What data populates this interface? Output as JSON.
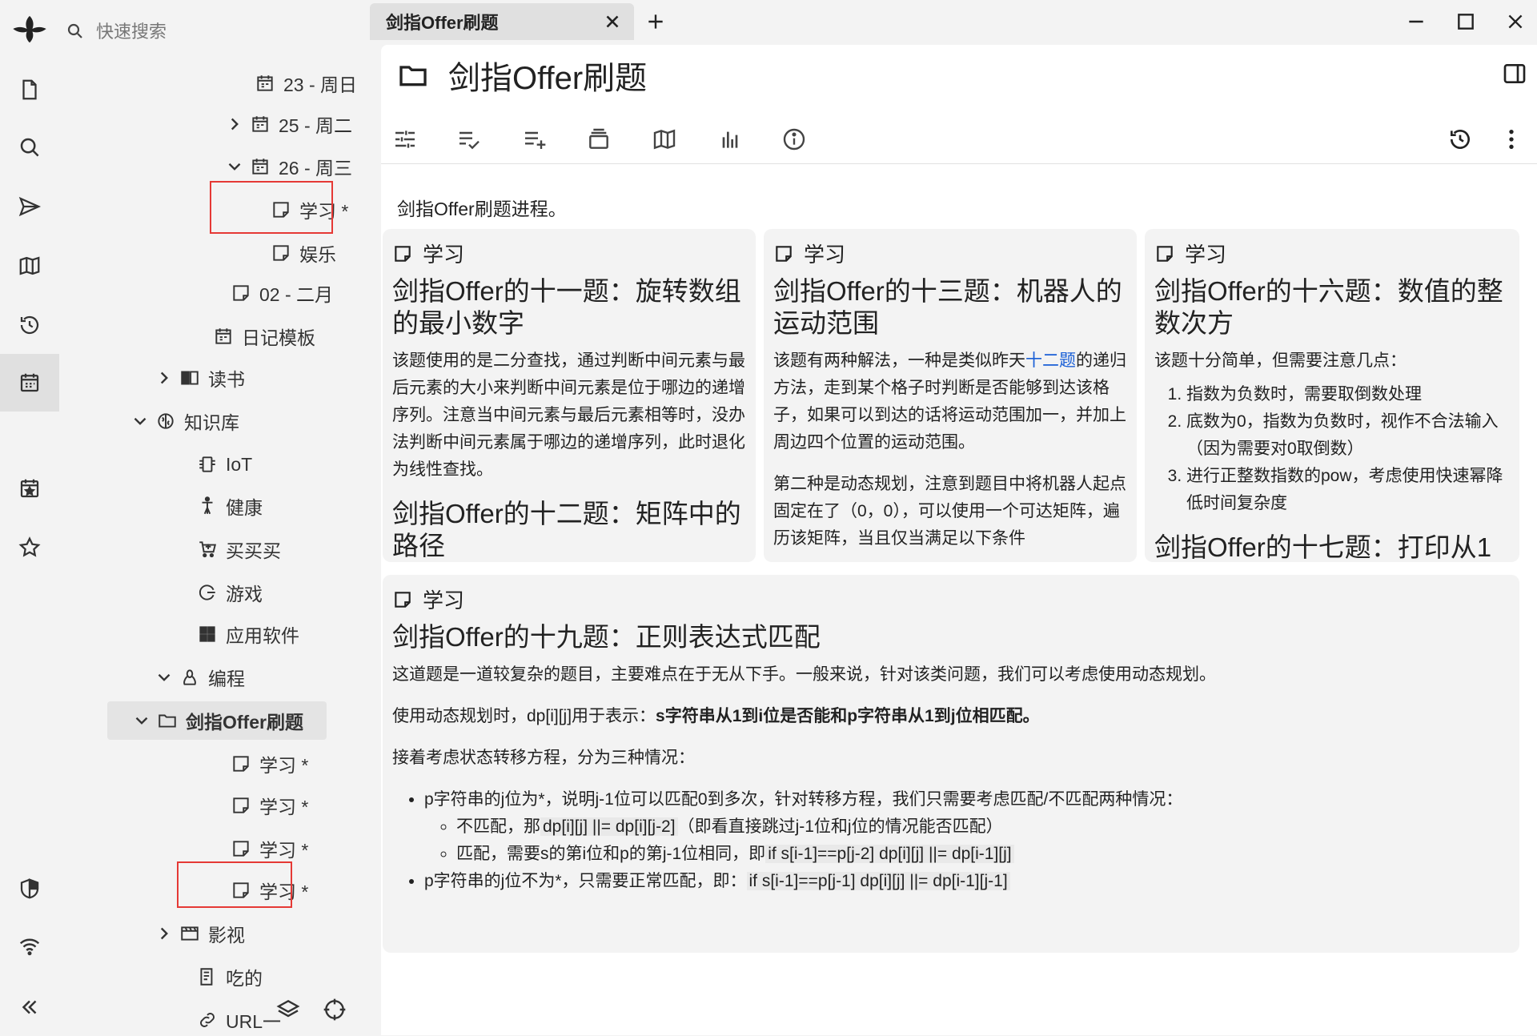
{
  "app": {
    "search_placeholder": "快速搜索"
  },
  "tabs": [
    {
      "title": "剑指Offer刷题"
    }
  ],
  "tree": [
    {
      "label": "23 - 周日",
      "icon": "calendar-icon",
      "chev": "none"
    },
    {
      "label": "25 - 周二",
      "icon": "calendar-icon",
      "chev": "right"
    },
    {
      "label": "26 - 周三",
      "icon": "calendar-icon",
      "chev": "down"
    },
    {
      "label": "学习 *",
      "icon": "note-icon",
      "chev": "none"
    },
    {
      "label": "娱乐",
      "icon": "note-icon",
      "chev": "none"
    },
    {
      "label": "02 - 二月",
      "icon": "note-icon",
      "chev": "none"
    },
    {
      "label": "日记模板",
      "icon": "calendar-icon",
      "chev": "none"
    },
    {
      "label": "读书",
      "icon": "book-icon",
      "chev": "right"
    },
    {
      "label": "知识库",
      "icon": "brain-icon",
      "chev": "down"
    },
    {
      "label": "IoT",
      "icon": "chip-icon",
      "chev": "none"
    },
    {
      "label": "健康",
      "icon": "person-icon",
      "chev": "none"
    },
    {
      "label": "买买买",
      "icon": "cart-icon",
      "chev": "none"
    },
    {
      "label": "游戏",
      "icon": "game-icon",
      "chev": "none"
    },
    {
      "label": "应用软件",
      "icon": "apps-icon",
      "chev": "none"
    },
    {
      "label": "编程",
      "icon": "linux-icon",
      "chev": "down"
    },
    {
      "label": "剑指Offer刷题",
      "icon": "folder-icon",
      "chev": "down"
    },
    {
      "label": "学习 *",
      "icon": "note-icon",
      "chev": "none"
    },
    {
      "label": "学习 *",
      "icon": "note-icon",
      "chev": "none"
    },
    {
      "label": "学习 *",
      "icon": "note-icon",
      "chev": "none"
    },
    {
      "label": "学习 *",
      "icon": "note-icon",
      "chev": "none"
    },
    {
      "label": "影视",
      "icon": "film-icon",
      "chev": "right"
    },
    {
      "label": "吃的",
      "icon": "menu-book-icon",
      "chev": "none"
    },
    {
      "label": "URL一",
      "icon": "link-icon",
      "chev": "none"
    }
  ],
  "note": {
    "title": "剑指Offer刷题",
    "description": "剑指Offer刷题进程。"
  },
  "cards": [
    {
      "label": "学习",
      "title1": "剑指Offer的十一题：旋转数组的最小数字",
      "para1": "该题使用的是二分查找，通过判断中间元素与最后元素的大小来判断中间元素是位于哪边的递增序列。注意当中间元素与最后元素相等时，没办法判断中间元素属于哪边的递增序列，此时退化为线性查找。",
      "title2": "剑指Offer的十二题：矩阵中的路径"
    },
    {
      "label": "学习",
      "title1": "剑指Offer的十三题：机器人的运动范围",
      "para1_a": "该题有两种解法，一种是类似昨天",
      "para1_link": "十二题",
      "para1_b": "的递归方法，走到某个格子时判断是否能够到达该格子，如果可以到达的话将运动范围加一，并加上周边四个位置的运动范围。",
      "para2": "第二种是动态规划，注意到题目中将机器人起点固定在了（0，0），可以使用一个可达矩阵，遍历该矩阵，当且仅当满足以下条件"
    },
    {
      "label": "学习",
      "title1": "剑指Offer的十六题：数值的整数次方",
      "para1": "该题十分简单，但需要注意几点：",
      "items": [
        "指数为负数时，需要取倒数处理",
        "底数为0，指数为负数时，视作不合法输入（因为需要对0取倒数）",
        "进行正整数指数的pow，考虑使用快速幂降低时间复杂度"
      ],
      "title2": "剑指Offer的十七题：打印从1"
    },
    {
      "label": "学习",
      "title1": "剑指Offer的十九题：正则表达式匹配",
      "para1": "这道题是一道较复杂的题目，主要难点在于无从下手。一般来说，针对该类问题，我们可以考虑使用动态规划。",
      "para2_a": "使用动态规划时，dp[i][j]用于表示：",
      "para2_b": "s字符串从1到i位是否能和p字符串从1到j位相匹配。",
      "para3": "接着考虑状态转移方程，分为三种情况：",
      "b1": "p字符串的j位为*，说明j-1位可以匹配0到多次，针对转移方程，我们只需要考虑匹配/不匹配两种情况：",
      "b1_1_a": "不匹配，那",
      "b1_1_code": "dp[i][j] ||= dp[i][j-2]",
      "b1_1_b": "（即看直接跳过j-1位和j位的情况能否匹配）",
      "b1_2_a": "匹配，需要s的第i位和p的第j-1位相同，即",
      "b1_2_code": "if s[i-1]==p[j-2] dp[i][j] ||= dp[i-1][j]",
      "b2_a": "p字符串的j位不为*，只需要正常匹配，即：",
      "b2_code": "if s[i-1]==p[j-1] dp[i][j] ||= dp[i-1][j-1]"
    }
  ]
}
